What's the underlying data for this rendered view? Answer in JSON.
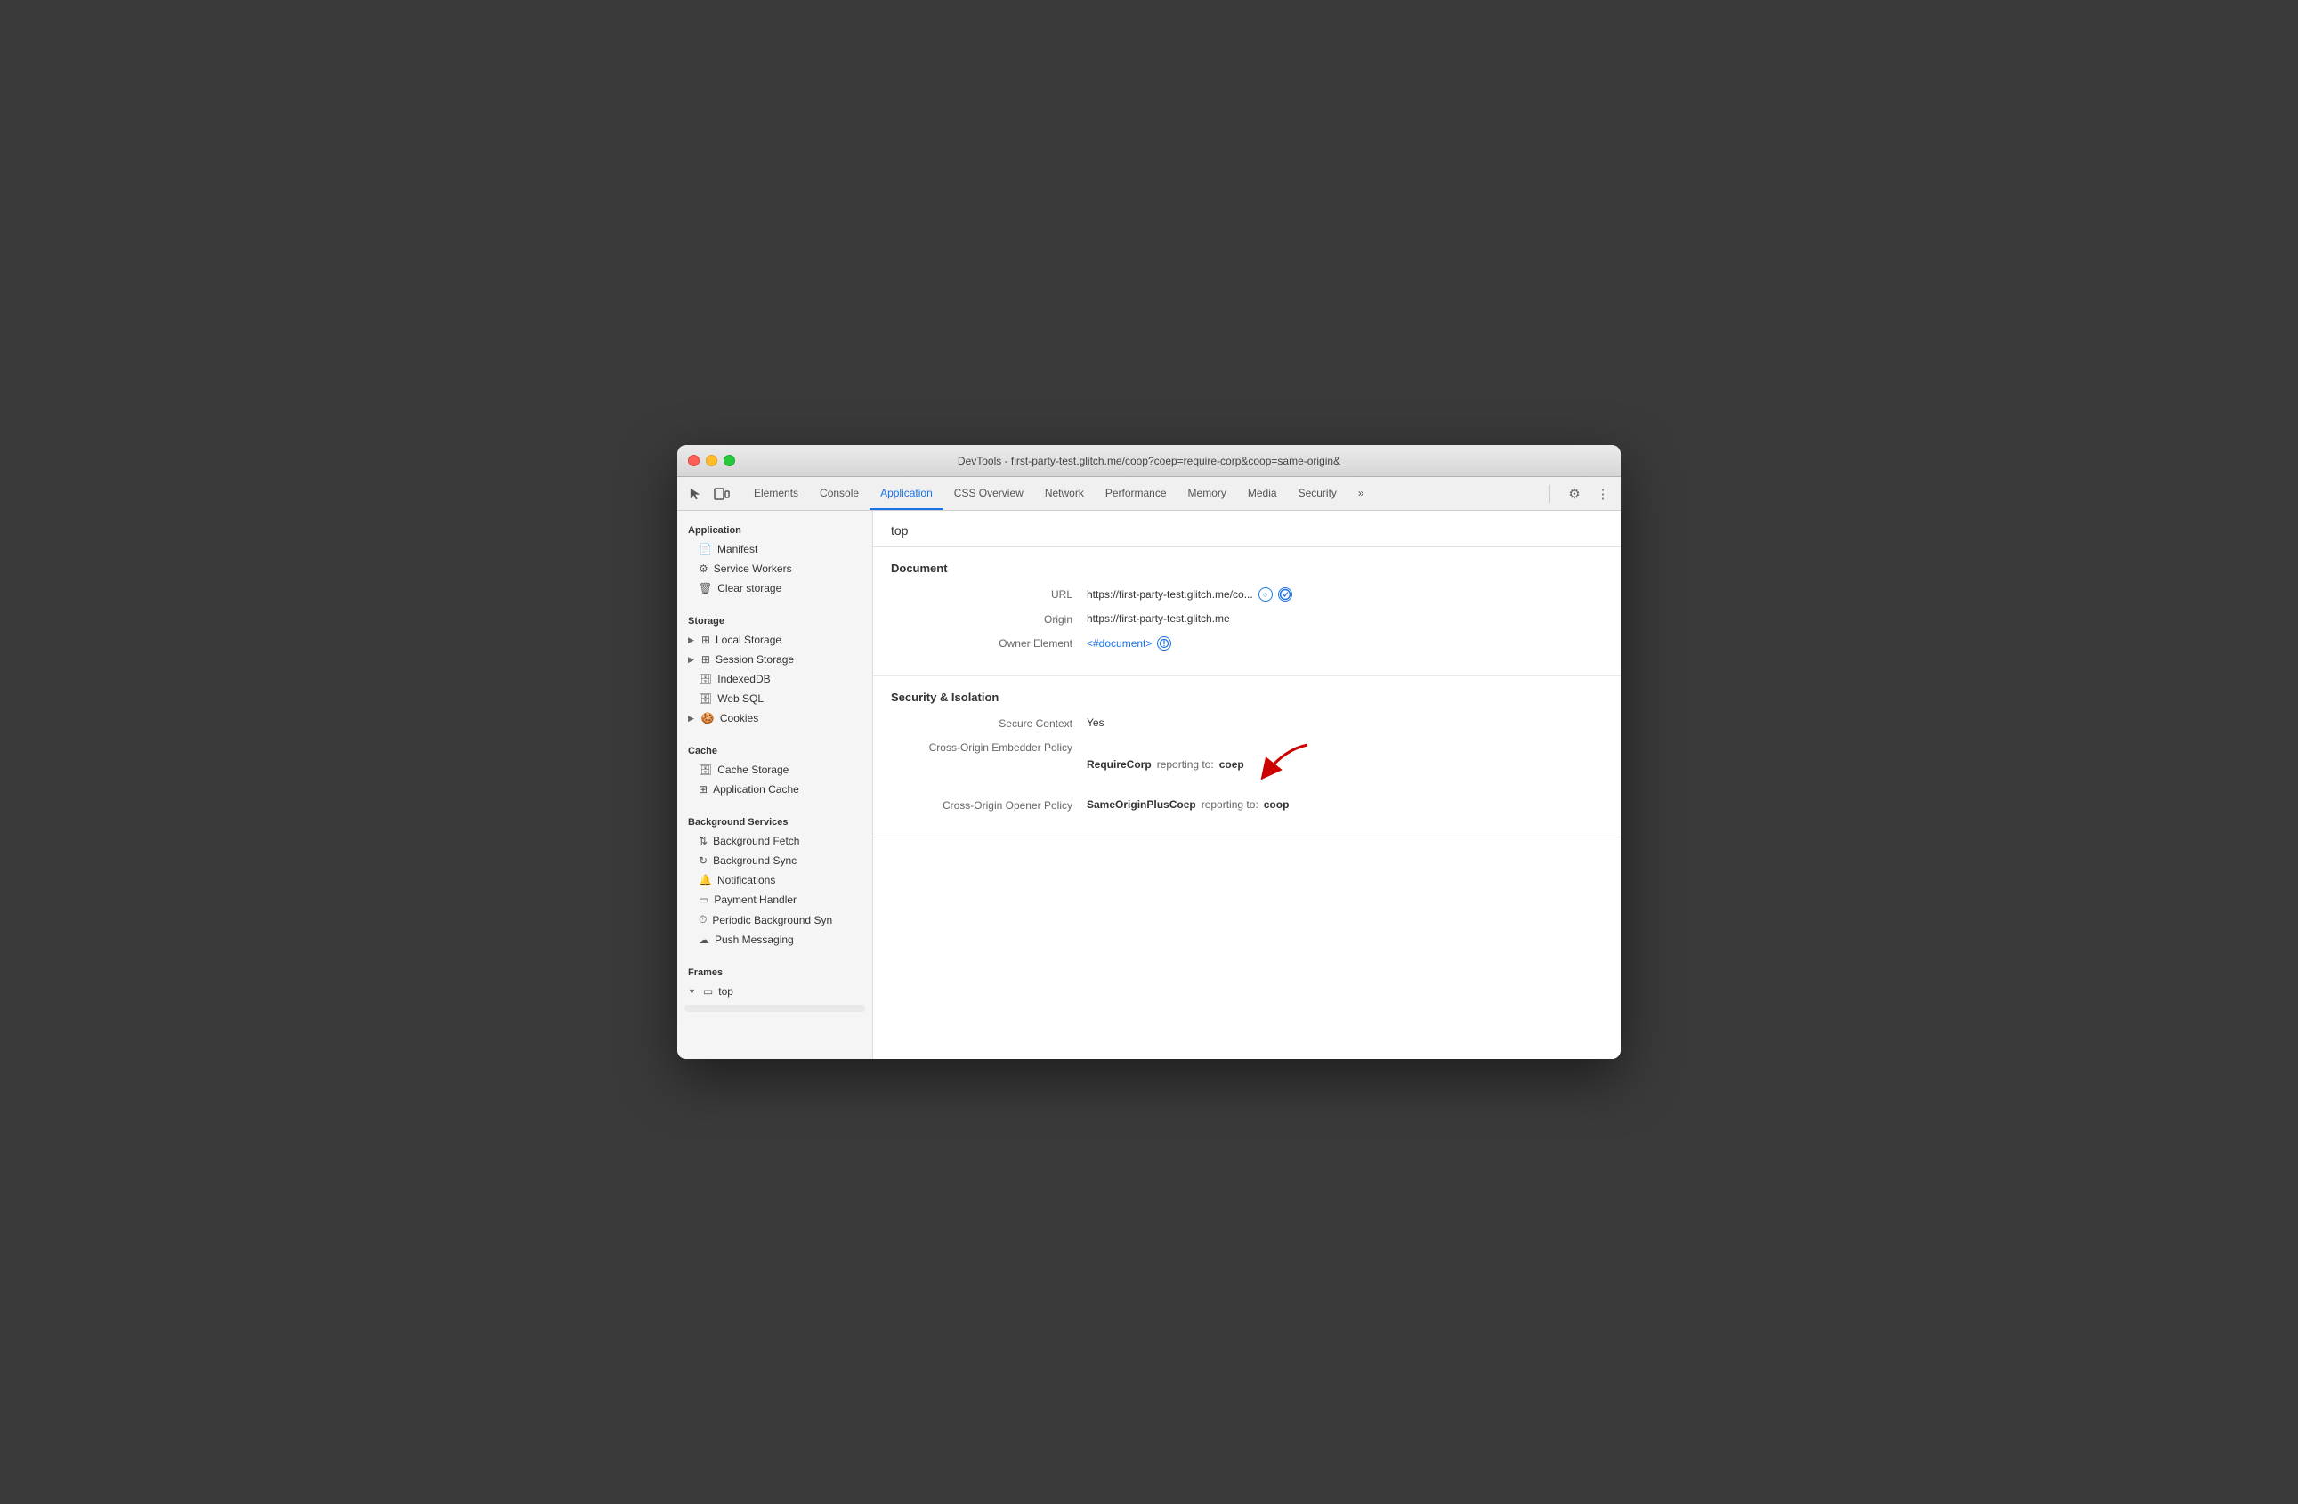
{
  "titlebar": {
    "title": "DevTools - first-party-test.glitch.me/coop?coep=require-corp&coop=same-origin&"
  },
  "tabs": [
    {
      "id": "elements",
      "label": "Elements",
      "active": false
    },
    {
      "id": "console",
      "label": "Console",
      "active": false
    },
    {
      "id": "application",
      "label": "Application",
      "active": true
    },
    {
      "id": "css-overview",
      "label": "CSS Overview",
      "active": false
    },
    {
      "id": "network",
      "label": "Network",
      "active": false
    },
    {
      "id": "performance",
      "label": "Performance",
      "active": false
    },
    {
      "id": "memory",
      "label": "Memory",
      "active": false
    },
    {
      "id": "media",
      "label": "Media",
      "active": false
    },
    {
      "id": "security",
      "label": "Security",
      "active": false
    }
  ],
  "sidebar": {
    "application_section": "Application",
    "manifest_label": "Manifest",
    "service_workers_label": "Service Workers",
    "clear_storage_label": "Clear storage",
    "storage_section": "Storage",
    "local_storage_label": "Local Storage",
    "session_storage_label": "Session Storage",
    "indexeddb_label": "IndexedDB",
    "websql_label": "Web SQL",
    "cookies_label": "Cookies",
    "cache_section": "Cache",
    "cache_storage_label": "Cache Storage",
    "application_cache_label": "Application Cache",
    "background_services_section": "Background Services",
    "background_fetch_label": "Background Fetch",
    "background_sync_label": "Background Sync",
    "notifications_label": "Notifications",
    "payment_handler_label": "Payment Handler",
    "periodic_bg_sync_label": "Periodic Background Syn",
    "push_messaging_label": "Push Messaging",
    "frames_section": "Frames",
    "top_frame_label": "top"
  },
  "content": {
    "frame_label": "top",
    "document_section": "Document",
    "url_label": "URL",
    "url_value": "https://first-party-test.glitch.me/co...",
    "origin_label": "Origin",
    "origin_value": "https://first-party-test.glitch.me",
    "owner_element_label": "Owner Element",
    "owner_element_value": "<#document>",
    "security_section": "Security & Isolation",
    "secure_context_label": "Secure Context",
    "secure_context_value": "Yes",
    "coep_label": "Cross-Origin Embedder Policy",
    "coep_value": "RequireCorp",
    "coep_reporting_label": "reporting to:",
    "coep_reporting_value": "coep",
    "coop_label": "Cross-Origin Opener Policy",
    "coop_value": "SameOriginPlusCoep",
    "coop_reporting_label": "reporting to:",
    "coop_reporting_value": "coop"
  }
}
